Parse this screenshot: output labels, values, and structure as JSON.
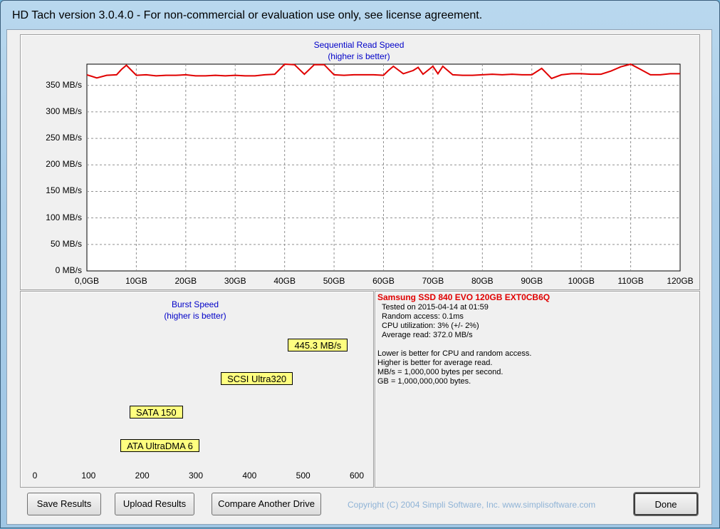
{
  "window": {
    "title": "HD Tach version 3.0.4.0  - For non-commercial or evaluation use only, see license agreement."
  },
  "colors": {
    "accent": "#e00000",
    "title_blue": "#0000c8",
    "bar_gray": "#808080",
    "label_yellow": "#ffff80"
  },
  "seq_chart": {
    "title_line1": "Sequential Read Speed",
    "title_line2": "(higher is better)",
    "y_ticks": [
      "0 MB/s",
      "50 MB/s",
      "100 MB/s",
      "150 MB/s",
      "200 MB/s",
      "250 MB/s",
      "300 MB/s",
      "350 MB/s"
    ],
    "x_ticks": [
      "0,0GB",
      "10GB",
      "20GB",
      "30GB",
      "40GB",
      "50GB",
      "60GB",
      "70GB",
      "80GB",
      "90GB",
      "100GB",
      "110GB",
      "120GB"
    ]
  },
  "burst_chart": {
    "title_line1": "Burst Speed",
    "title_line2": "(higher is better)",
    "x_ticks": [
      "0",
      "100",
      "200",
      "300",
      "400",
      "500",
      "600"
    ]
  },
  "info": {
    "drive": "Samsung SSD 840 EVO 120GB EXT0CB6Q",
    "tested": "Tested on 2015-04-14 at 01:59",
    "random_access": "Random access: 0.1ms",
    "cpu": "CPU utilization: 3% (+/- 2%)",
    "avg_read": "Average read: 372.0 MB/s",
    "note1": "Lower is better for CPU and random access.",
    "note2": "Higher is better for average read.",
    "note3": "MB/s = 1,000,000 bytes per second.",
    "note4": "GB = 1,000,000,000 bytes."
  },
  "buttons": {
    "save": "Save Results",
    "upload": "Upload Results",
    "compare": "Compare Another Drive",
    "done": "Done"
  },
  "copyright": "Copyright (C) 2004 Simpli Software, Inc. www.simplisoftware.com",
  "chart_data": [
    {
      "type": "line",
      "title": "Sequential Read Speed",
      "subtitle": "(higher is better)",
      "xlabel": "",
      "ylabel": "",
      "xlim": [
        0,
        120
      ],
      "ylim": [
        0,
        390
      ],
      "grid": true,
      "series": [
        {
          "x": [
            0,
            2,
            4,
            6,
            7,
            8,
            10,
            12,
            14,
            16,
            18,
            20,
            22,
            24,
            26,
            28,
            30,
            32,
            34,
            36,
            38,
            40,
            42,
            44,
            46,
            48,
            50,
            52,
            54,
            56,
            58,
            60,
            61,
            62,
            64,
            66,
            67,
            68,
            70,
            71,
            72,
            74,
            76,
            78,
            80,
            82,
            84,
            86,
            88,
            90,
            92,
            94,
            96,
            98,
            100,
            102,
            104,
            106,
            108,
            110,
            112,
            114,
            116,
            118,
            120
          ],
          "y": [
            370,
            364,
            369,
            370,
            380,
            388,
            369,
            370,
            368,
            369,
            369,
            370,
            368,
            368,
            369,
            368,
            369,
            368,
            368,
            370,
            371,
            390,
            389,
            371,
            389,
            389,
            370,
            369,
            370,
            370,
            370,
            369,
            378,
            386,
            372,
            378,
            384,
            371,
            386,
            372,
            386,
            370,
            369,
            369,
            370,
            371,
            370,
            371,
            370,
            370,
            382,
            363,
            370,
            372,
            372,
            371,
            371,
            377,
            385,
            390,
            380,
            370,
            370,
            372,
            372
          ]
        }
      ]
    },
    {
      "type": "bar",
      "title": "Burst Speed",
      "subtitle": "(higher is better)",
      "orientation": "horizontal",
      "xlim": [
        0,
        600
      ],
      "categories": [
        "445.3 MB/s",
        "SCSI Ultra320",
        "SATA 150",
        "ATA UltraDMA 6"
      ],
      "values": [
        445.3,
        320,
        150,
        133
      ],
      "colors": [
        "#ff0000",
        "#808080",
        "#808080",
        "#808080"
      ]
    }
  ]
}
